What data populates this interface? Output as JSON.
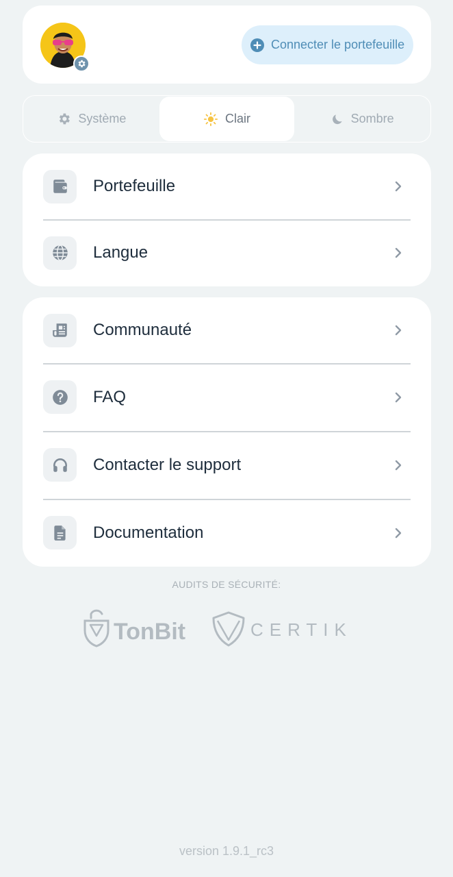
{
  "header": {
    "connect_label": "Connecter le portefeuille"
  },
  "theme": {
    "options": [
      {
        "label": "Système",
        "icon": "gear-icon",
        "active": false
      },
      {
        "label": "Clair",
        "icon": "sun-icon",
        "active": true
      },
      {
        "label": "Sombre",
        "icon": "moon-icon",
        "active": false
      }
    ]
  },
  "menu_primary": [
    {
      "label": "Portefeuille",
      "icon": "wallet-icon"
    },
    {
      "label": "Langue",
      "icon": "globe-icon"
    }
  ],
  "menu_secondary": [
    {
      "label": "Communauté",
      "icon": "news-icon"
    },
    {
      "label": "FAQ",
      "icon": "question-icon"
    },
    {
      "label": "Contacter le support",
      "icon": "headphones-icon"
    },
    {
      "label": "Documentation",
      "icon": "document-icon"
    }
  ],
  "audits": {
    "heading": "AUDITS DE SÉCURITÉ:",
    "logo_tonbit": "TonBit",
    "logo_certik": "CERTIK"
  },
  "footer": {
    "version": "version 1.9.1_rc3"
  },
  "colors": {
    "background": "#eff3f4",
    "accent": "#4f8db6",
    "text_primary": "#1e2d3c",
    "muted": "#a0aab3"
  }
}
